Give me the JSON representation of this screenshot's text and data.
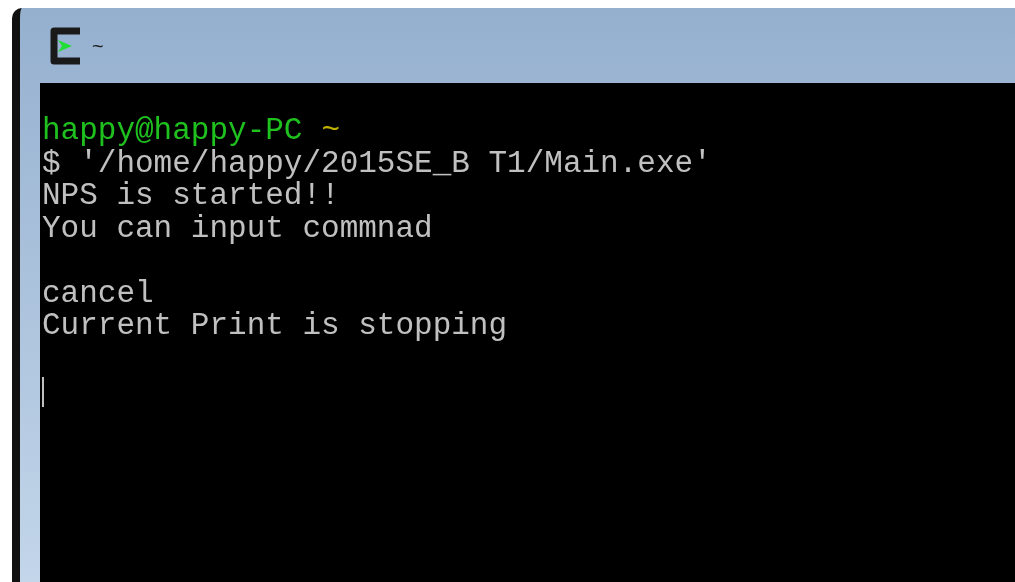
{
  "window": {
    "title": "~"
  },
  "terminal": {
    "lines": [
      {
        "kind": "prompt",
        "user_host": "happy@happy-PC",
        "path": "~"
      },
      {
        "kind": "text",
        "text": "$ '/home/happy/2015SE_B T1/Main.exe'"
      },
      {
        "kind": "text",
        "text": "NPS is started!!"
      },
      {
        "kind": "text",
        "text": "You can input commnad"
      },
      {
        "kind": "blank"
      },
      {
        "kind": "text",
        "text": "cancel"
      },
      {
        "kind": "text",
        "text": "Current Print is stopping"
      },
      {
        "kind": "blank"
      },
      {
        "kind": "cursor"
      }
    ]
  }
}
